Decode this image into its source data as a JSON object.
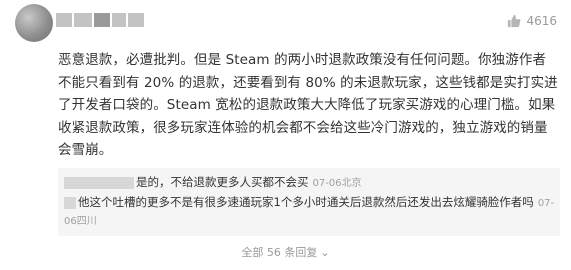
{
  "comment": {
    "likes": "4616",
    "body": "恶意退款，必遭批判。但是 Steam 的两小时退款政策没有任何问题。你独游作者不能只看到有 20% 的退款，还要看到有 80% 的未退款玩家，这些钱都是实打实进了开发者口袋的。Steam 宽松的退款政策大大降低了玩家买游戏的心理门槛。如果收紧退款政策，很多玩家连体验的机会都不会给这些冷门游戏的，独立游戏的销量会雪崩。"
  },
  "replies": [
    {
      "text": "是的，不给退款更多人买都不会买",
      "date": "07-06",
      "location": "北京"
    },
    {
      "text": "他这个吐槽的更多不是有很多速通玩家1个多小时通关后退款然后还发出去炫耀骑脸作者吗",
      "date": "07-06",
      "location": "四川"
    }
  ],
  "more_replies": {
    "label": "全部 56 条回复"
  },
  "icons": {
    "like": "thumbs-up-icon",
    "expand": "chevron-down-icon"
  }
}
